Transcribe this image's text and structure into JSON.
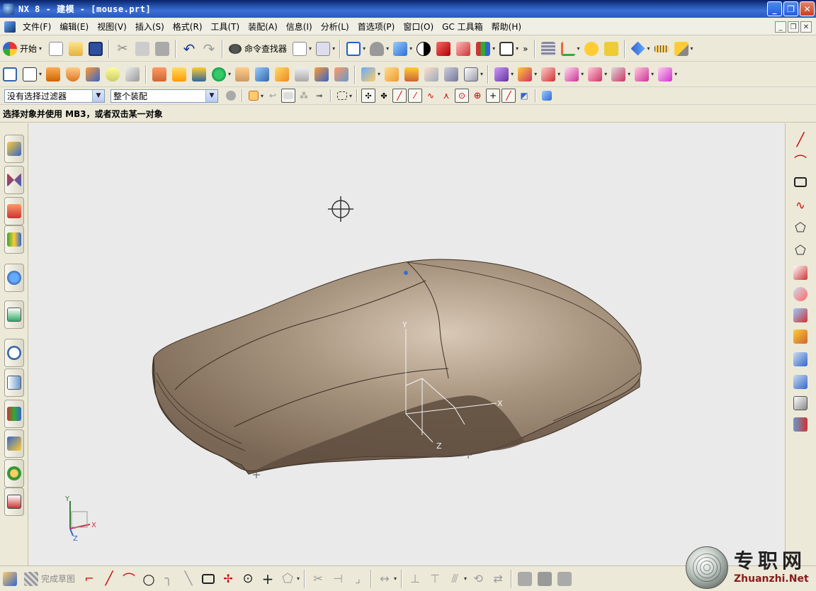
{
  "window": {
    "title": "NX 8 - 建模 - [mouse.prt]",
    "controls": [
      "minimize",
      "restore",
      "close"
    ]
  },
  "menubar": {
    "items": [
      "文件(F)",
      "编辑(E)",
      "视图(V)",
      "插入(S)",
      "格式(R)",
      "工具(T)",
      "装配(A)",
      "信息(I)",
      "分析(L)",
      "首选项(P)",
      "窗口(O)",
      "GC 工具箱",
      "帮助(H)"
    ]
  },
  "toolbar": {
    "start_label": "开始",
    "command_finder_label": "命令查找器"
  },
  "selection_bar": {
    "filter_value": "没有选择过滤器",
    "scope_value": "整个装配"
  },
  "cue_line": {
    "text": "选择对象并使用 MB3，或者双击某一对象"
  },
  "viewport": {
    "background": "#ebeaea",
    "model_color": "#a89580",
    "csys_labels": {
      "x": "X",
      "y": "Y",
      "z": "Z"
    },
    "triad_labels": {
      "x": "X",
      "y": "Y",
      "z": "Z"
    }
  },
  "sketch_bar": {
    "finish_label": "完成草图"
  },
  "watermark": {
    "cn": "专职网",
    "en": "Zhuanzhi.Net"
  }
}
